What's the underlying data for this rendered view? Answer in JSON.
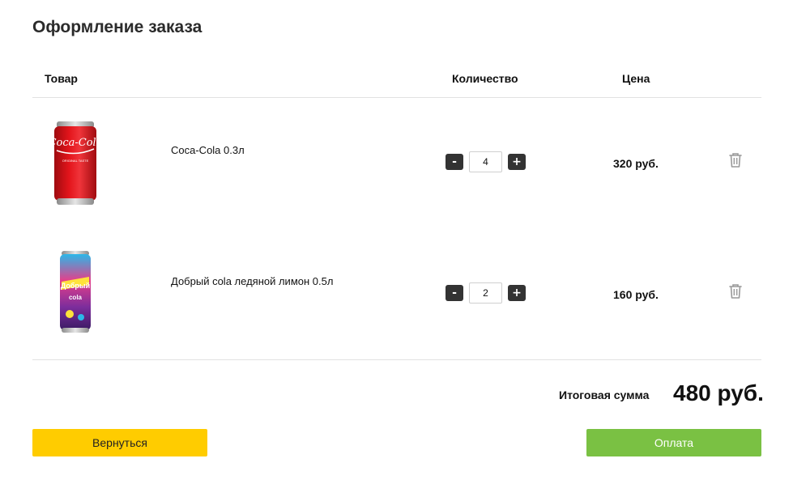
{
  "page": {
    "title": "Оформление заказа"
  },
  "table": {
    "headers": {
      "product": "Товар",
      "quantity": "Количество",
      "price": "Цена"
    }
  },
  "items": [
    {
      "name": "Coca-Cola 0.3л",
      "quantity": "4",
      "price": "320 руб.",
      "image_icon": "coca-cola-can-image",
      "image_text": "Coca-Cola"
    },
    {
      "name": "Добрый cola ледяной лимон 0.5л",
      "quantity": "2",
      "price": "160 руб.",
      "image_icon": "dobry-cola-can-image",
      "image_text": "Добрый cola"
    }
  ],
  "qty_controls": {
    "minus": "-",
    "plus": "+"
  },
  "summary": {
    "total_label": "Итоговая сумма",
    "total_value": "480 руб."
  },
  "actions": {
    "back_label": "Вернуться",
    "pay_label": "Оплата"
  },
  "colors": {
    "back_button": "#ffcc00",
    "pay_button": "#7ac143",
    "qty_button": "#333333"
  }
}
